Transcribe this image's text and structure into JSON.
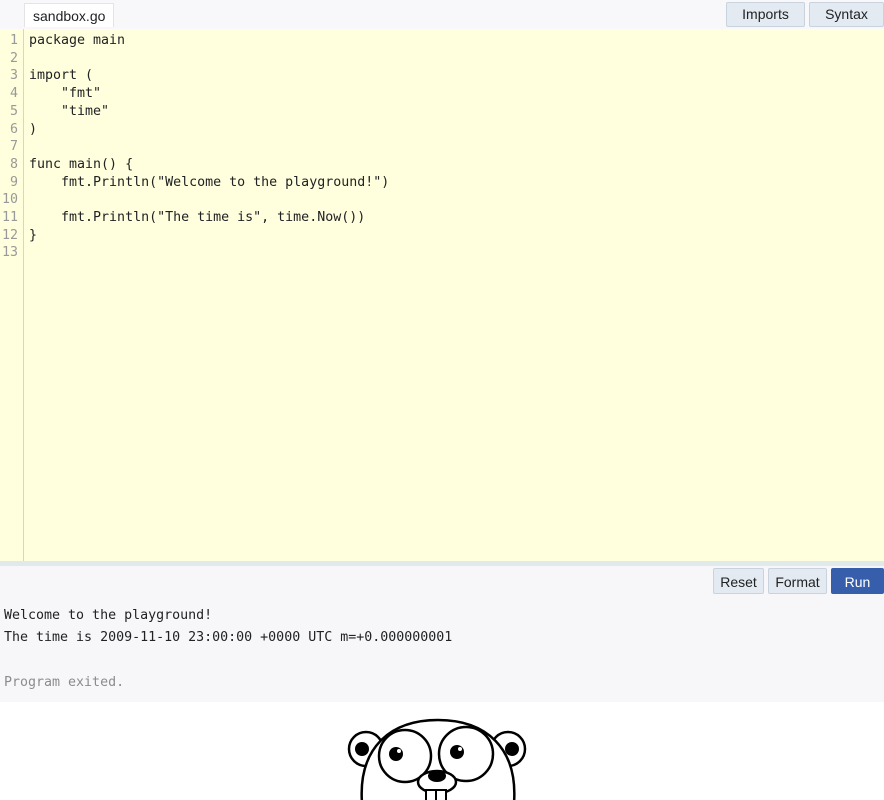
{
  "header": {
    "file_tab": "sandbox.go",
    "imports_button": "Imports off",
    "syntax_button": "Syntax off"
  },
  "editor": {
    "line_numbers": [
      "1",
      "2",
      "3",
      "4",
      "5",
      "6",
      "7",
      "8",
      "9",
      "10",
      "11",
      "12",
      "13"
    ],
    "lines": [
      "package main",
      "",
      "import (",
      "    \"fmt\"",
      "    \"time\"",
      ")",
      "",
      "func main() {",
      "    fmt.Println(\"Welcome to the playground!\")",
      "",
      "    fmt.Println(\"The time is\", time.Now())",
      "}",
      ""
    ]
  },
  "toolbar": {
    "reset_label": "Reset",
    "format_label": "Format",
    "run_label": "Run"
  },
  "output": {
    "lines": [
      "Welcome to the playground!",
      "The time is 2009-11-10 23:00:00 +0000 UTC m=+0.000000001"
    ],
    "exit_message": "Program exited."
  },
  "colors": {
    "editor_background": "#ffffdd",
    "run_button": "#375eab",
    "button_background": "#e4eaf1",
    "output_background": "#f7f7f9"
  },
  "icons": {
    "mascot": "gopher-mascot"
  }
}
